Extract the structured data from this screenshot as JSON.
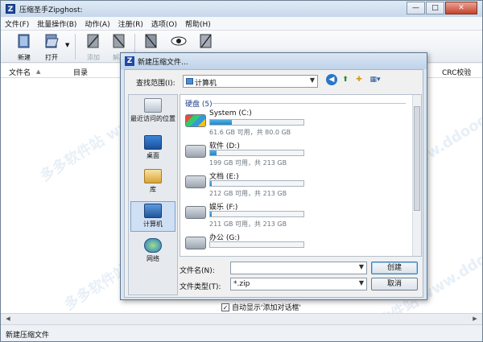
{
  "window": {
    "app_icon": "Z",
    "title": "压缩圣手Zipghost:",
    "minimize": "—",
    "maximize": "□",
    "close": "✕"
  },
  "menubar": {
    "items": [
      "文件(F)",
      "批量操作(B)",
      "动作(A)",
      "注册(R)",
      "选项(O)",
      "帮助(H)"
    ]
  },
  "toolbar": {
    "new_label": "新建",
    "open_label": "打开",
    "add_label": "添加",
    "extract_label": "解压"
  },
  "columns": {
    "filename": "文件名",
    "directory": "目录",
    "crc": "CRC校验"
  },
  "status": {
    "text": "新建压缩文件"
  },
  "dialog": {
    "icon": "Z",
    "title": "新建压缩文件...",
    "lookin_label": "查找范围(I):",
    "lookin_value": "计算机",
    "places": [
      "最近访问的位置",
      "桌面",
      "库",
      "计算机",
      "网络"
    ],
    "group_label": "硬盘 (5)",
    "drives": [
      {
        "name": "System (C:)",
        "size": "61.6 GB 可用，共 80.0 GB",
        "used_fraction": 0.23
      },
      {
        "name": "软件 (D:)",
        "size": "199 GB 可用，共 213 GB",
        "used_fraction": 0.07
      },
      {
        "name": "文档 (E:)",
        "size": "212 GB 可用，共 213 GB",
        "used_fraction": 0.005
      },
      {
        "name": "娱乐 (F:)",
        "size": "211 GB 可用，共 213 GB",
        "used_fraction": 0.01
      },
      {
        "name": "办公 (G:)",
        "size": "",
        "used_fraction": 0.0
      }
    ],
    "filename_label": "文件名(N):",
    "filename_value": "",
    "filetype_label": "文件类型(T):",
    "filetype_value": "*.zip",
    "create_button": "创建",
    "cancel_button": "取消",
    "checkbox_label": "自动显示'添加对话框'",
    "checkbox_checked": true
  },
  "watermark": "多多软件站 www.ddooo.com"
}
